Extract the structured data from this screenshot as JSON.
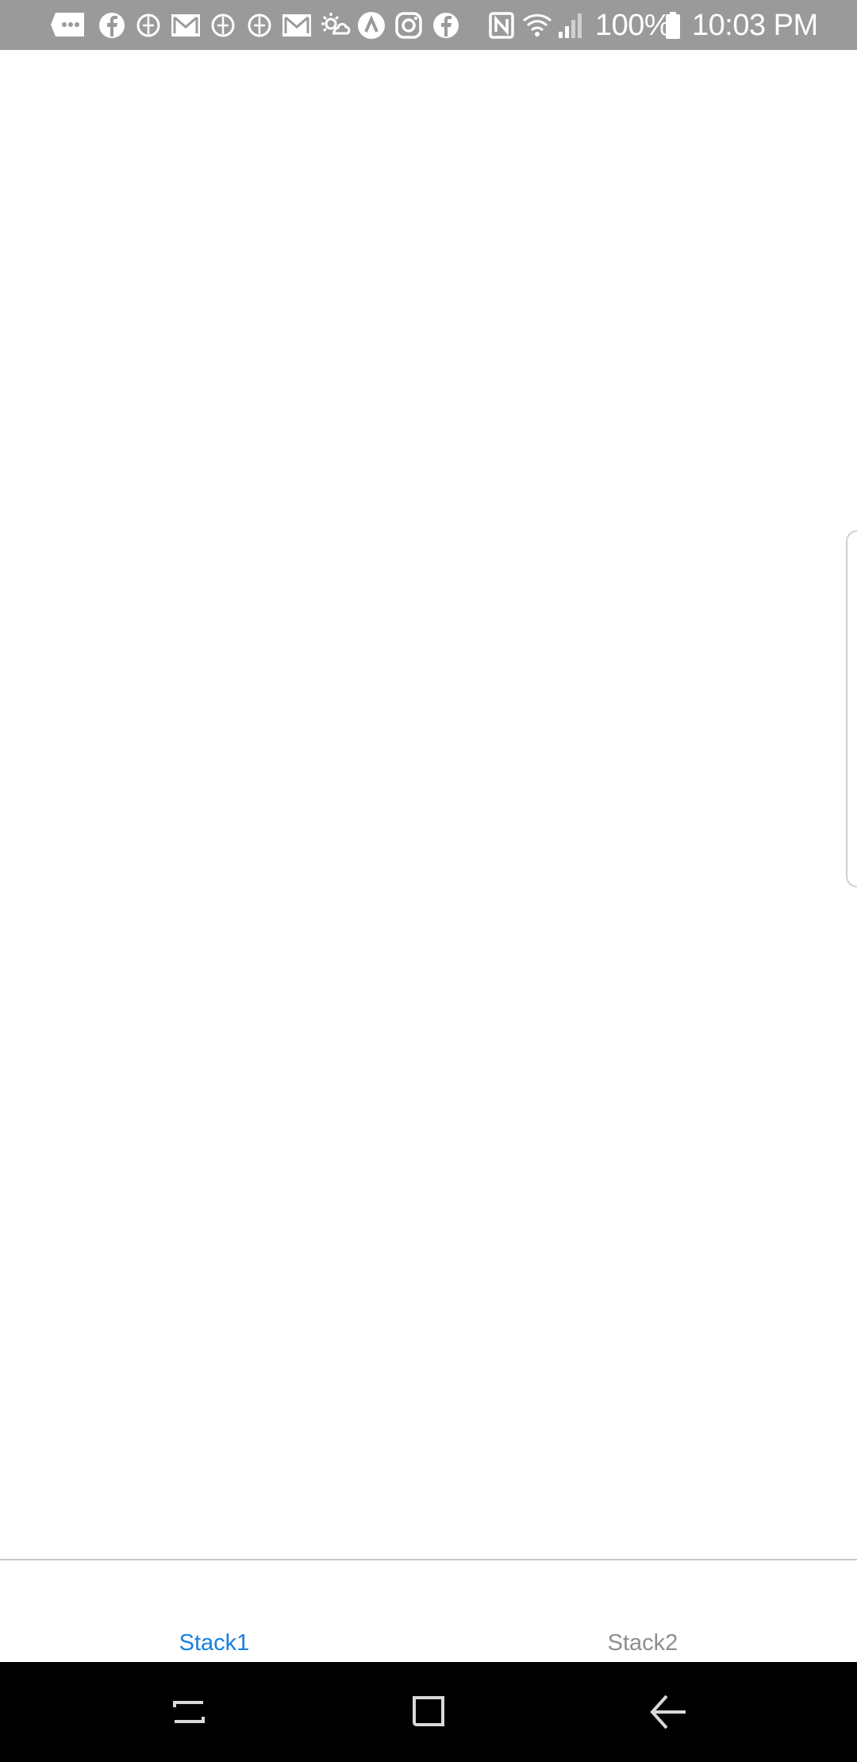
{
  "status_bar": {
    "battery_text": "100%",
    "time": "10:03 PM",
    "background_color": "#9a9a9a",
    "notification_icons": [
      "chat-icon",
      "facebook-icon",
      "app-icon",
      "gmail-icon",
      "app-icon",
      "app-icon",
      "gmail-icon",
      "weather-icon",
      "arrow-up-icon",
      "instagram-icon",
      "facebook-icon"
    ],
    "system_icons": [
      "nfc-icon",
      "wifi-icon",
      "signal-icon",
      "battery-icon"
    ]
  },
  "tabs": [
    {
      "label": "Stack1",
      "active": true,
      "color": "#1a7fe0"
    },
    {
      "label": "Stack2",
      "active": false,
      "color": "#8e8e93"
    }
  ],
  "nav_bar": {
    "buttons": [
      "recent-apps-icon",
      "home-icon",
      "back-icon"
    ]
  }
}
